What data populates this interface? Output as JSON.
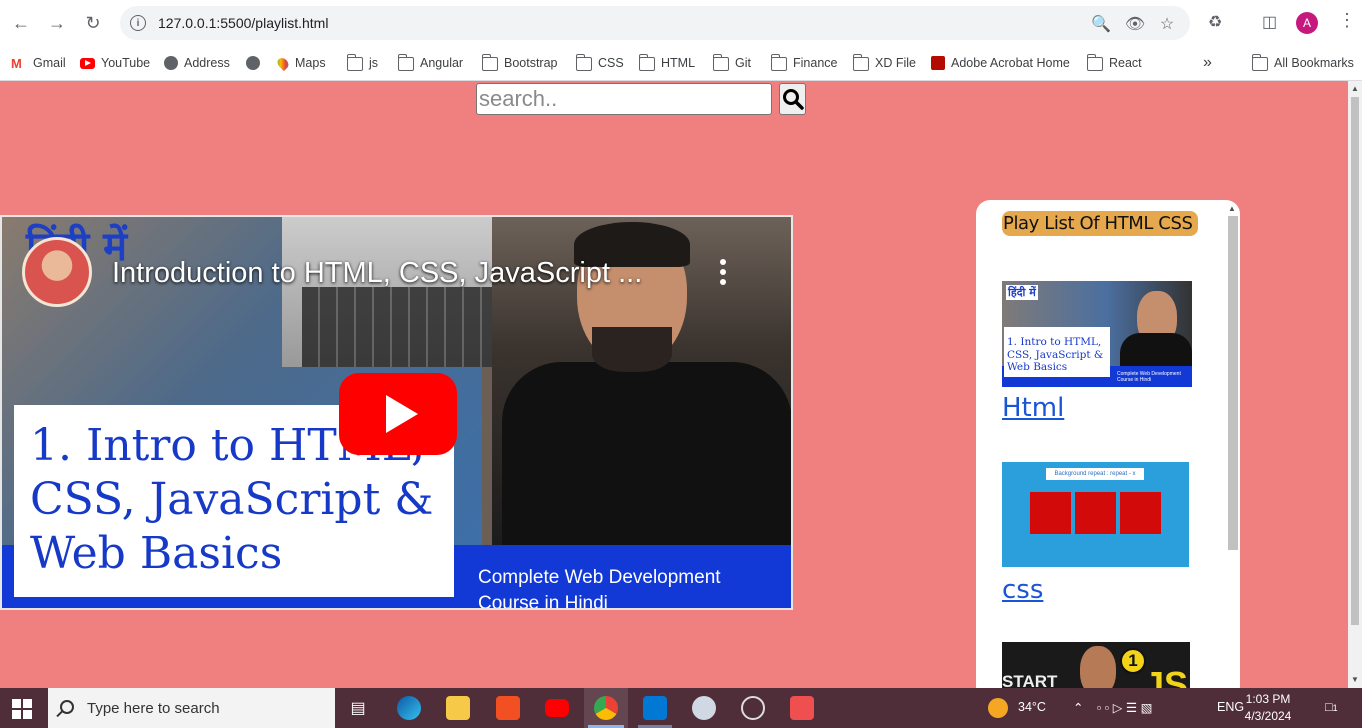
{
  "browser": {
    "url": "127.0.0.1:5500/playlist.html",
    "avatar_letter": "A",
    "bookmarks": [
      {
        "label": "Gmail",
        "icon": "gmail-icon"
      },
      {
        "label": "YouTube",
        "icon": "youtube-icon"
      },
      {
        "label": "Address",
        "icon": "globe-icon"
      },
      {
        "label": "",
        "icon": "globe-icon"
      },
      {
        "label": "Maps",
        "icon": "maps-pin-icon"
      },
      {
        "label": "js",
        "icon": "folder-icon"
      },
      {
        "label": "Angular",
        "icon": "folder-icon"
      },
      {
        "label": "Bootstrap",
        "icon": "folder-icon"
      },
      {
        "label": "CSS",
        "icon": "folder-icon"
      },
      {
        "label": "HTML",
        "icon": "folder-icon"
      },
      {
        "label": "Git",
        "icon": "folder-icon"
      },
      {
        "label": "Finance",
        "icon": "folder-icon"
      },
      {
        "label": "XD File",
        "icon": "folder-icon"
      },
      {
        "label": "Adobe Acrobat Home",
        "icon": "acrobat-icon"
      },
      {
        "label": "React",
        "icon": "folder-icon"
      }
    ],
    "all_bookmarks": "All Bookmarks",
    "overflow": "»"
  },
  "page": {
    "search_placeholder": "search..",
    "background": "#f08080",
    "video": {
      "hindi_tag": "हिंदी में",
      "title": "Introduction to HTML, CSS, JavaScript ...",
      "card_text": "1. Intro to HTML, CSS, JavaScript & Web Basics",
      "band_text": "Complete Web Development Course in Hindi"
    },
    "playlist": {
      "title": "Play List Of HTML CSS",
      "items": [
        {
          "label": "Html",
          "thumb_hindi": "हिंदी में",
          "thumb_text": "1. Intro to HTML, CSS, JavaScript & Web Basics",
          "thumb_sub": "Complete Web Development Course in Hindi"
        },
        {
          "label": "css",
          "thumb_text": "Background repeat : repeat - x"
        },
        {
          "label": "",
          "thumb_start": "START",
          "thumb_num": "1",
          "thumb_js": "JS"
        }
      ]
    }
  },
  "taskbar": {
    "search_placeholder": "Type here to search",
    "temperature": "34°C",
    "language": "ENG",
    "time": "1:03 PM",
    "date": "4/3/2024",
    "notification_count": "1",
    "weather_badge": "1"
  },
  "colors": {
    "accent": "#f08080",
    "playlist_title_bg": "#e5a84c",
    "link": "#1a55d6",
    "taskbar": "#4f2d39"
  }
}
